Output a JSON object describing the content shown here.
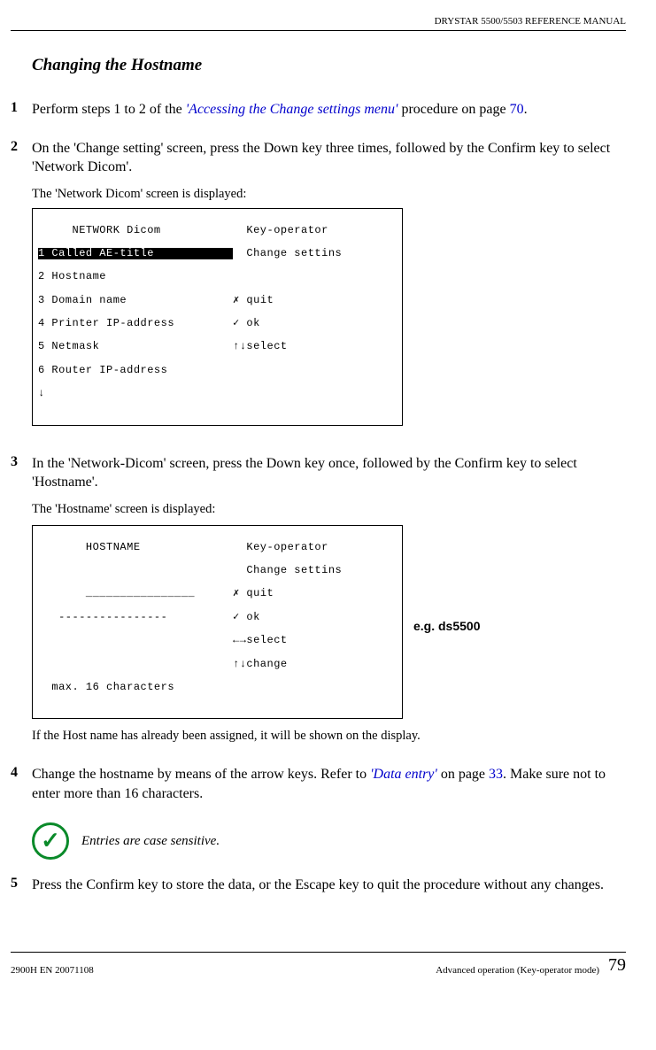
{
  "header": "DRYSTAR 5500/5503 REFERENCE MANUAL",
  "section_title": "Changing the Hostname",
  "steps": {
    "s1": {
      "num": "1",
      "t1": "Perform steps 1 to 2 of the ",
      "link": "'Accessing the Change settings menu'",
      "t2": " procedure on page ",
      "page": "70",
      "t3": "."
    },
    "s2": {
      "num": "2",
      "t1": "On the 'Change setting' screen, press the Down key three times, followed by the Confirm key to select 'Network Dicom'.",
      "sub": "The 'Network Dicom' screen is displayed:"
    },
    "s3": {
      "num": "3",
      "t1": "In the 'Network-Dicom' screen, press the Down key once, followed by the Confirm key to select 'Hostname'.",
      "sub": "The 'Hostname' screen is displayed:",
      "after": "If the Host name has already been assigned, it will be shown on the display."
    },
    "s4": {
      "num": "4",
      "t1": "Change the hostname by means of the arrow keys. Refer to ",
      "link": "'Data entry'",
      "t2": " on page ",
      "page": "33",
      "t3": ". Make sure not to enter more than 16 characters."
    },
    "s5": {
      "num": "5",
      "t1": "Press the Confirm key to store the data, or the Escape key to quit the procedure without any changes."
    }
  },
  "note": "Entries are case sensitive.",
  "annot": "e.g. ds5500",
  "lcd1": {
    "title_l": "     NETWORK Dicom",
    "title_r": "  Key-operator",
    "r1_l": "1 Called AE-title    ",
    "r1_r": "  Change settins",
    "r2_l": "2 Hostname",
    "r3_l": "3 Domain name",
    "r3_r": "✗ quit",
    "r4_l": "4 Printer IP-address",
    "r4_r": "✓ ok",
    "r5_l": "5 Netmask",
    "r5_r": "↑↓select",
    "r6_l": "6 Router IP-address",
    "r7_l": "↓"
  },
  "lcd2": {
    "title_l": "       HOSTNAME",
    "title_r": "  Key-operator",
    "r1_r": "  Change settins",
    "r2_l": "       ________________",
    "r2_r": "✗ quit",
    "r3_l": "   ----------------",
    "r3_r": "✓ ok",
    "r4_r": "←→select",
    "r5_r": "↑↓change",
    "r6_l": "  max. 16 characters"
  },
  "footer": {
    "left": "2900H EN 20071108",
    "right": "Advanced operation (Key-operator mode)",
    "page": "79"
  }
}
